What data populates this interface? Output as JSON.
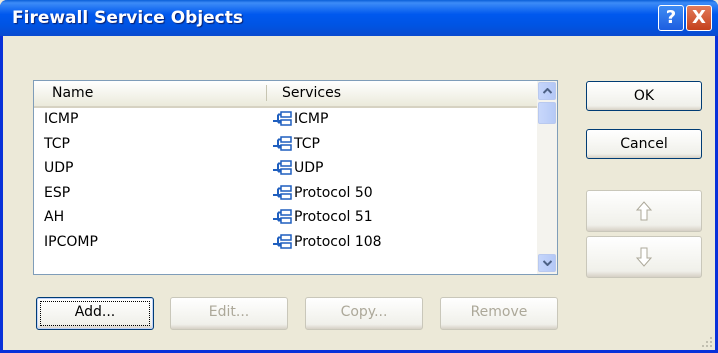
{
  "window": {
    "title": "Firewall Service Objects",
    "help_label": "?",
    "close_label": "X"
  },
  "list": {
    "columns": [
      "Name",
      "Services"
    ],
    "rows": [
      {
        "name": "ICMP",
        "service": "ICMP"
      },
      {
        "name": "TCP",
        "service": "TCP"
      },
      {
        "name": "UDP",
        "service": "UDP"
      },
      {
        "name": "ESP",
        "service": "Protocol 50"
      },
      {
        "name": "AH",
        "service": "Protocol 51"
      },
      {
        "name": "IPCOMP",
        "service": "Protocol 108"
      }
    ],
    "row_icon": "network-service-icon",
    "scroll_up_icon": "scroll-up-arrow-icon",
    "scroll_down_icon": "scroll-down-arrow-icon"
  },
  "buttons": {
    "ok": "OK",
    "cancel": "Cancel",
    "move_up_icon": "arrow-up-icon",
    "move_down_icon": "arrow-down-icon",
    "add": "Add...",
    "edit": "Edit...",
    "copy": "Copy...",
    "remove": "Remove"
  },
  "colors": {
    "titlebar": "#0054e3",
    "dialog_background": "#ece9d8",
    "disabled_text": "#aca899"
  }
}
